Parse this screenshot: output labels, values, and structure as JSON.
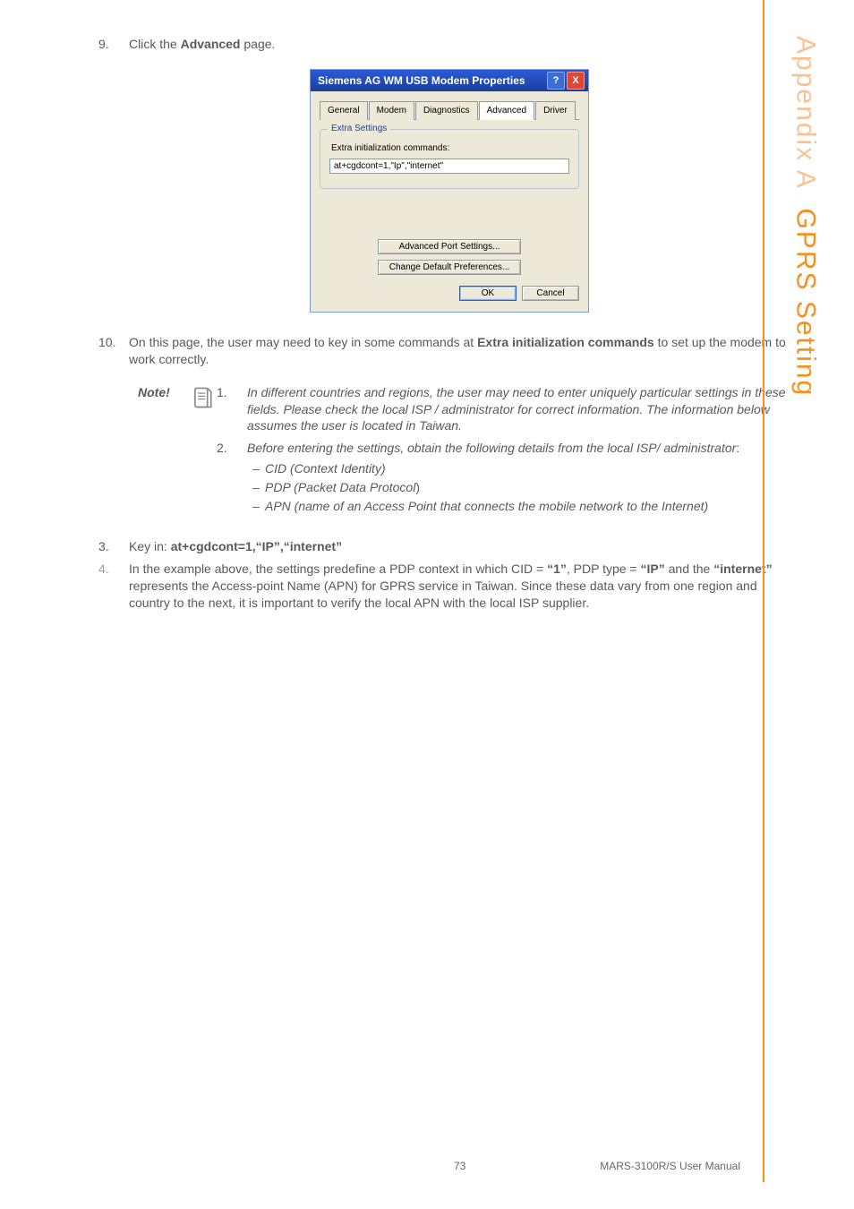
{
  "sidebar": {
    "appendix": "Appendix A",
    "section": "GPRS Setting"
  },
  "steps": {
    "s9_num": "9.",
    "s9_text_a": "Click the ",
    "s9_text_b": "Advanced",
    "s9_text_c": " page.",
    "s10_num": "10.",
    "s10_text_a": "On this page, the user may need to key in some commands at ",
    "s10_text_b": "Extra initialization commands",
    "s10_text_c": " to set up the modem to work correctly."
  },
  "dialog": {
    "title": "Siemens AG WM USB Modem Properties",
    "tabs": {
      "general": "General",
      "modem": "Modem",
      "diagnostics": "Diagnostics",
      "advanced": "Advanced",
      "driver": "Driver"
    },
    "group_legend": "Extra Settings",
    "init_label": "Extra initialization commands:",
    "init_value": "at+cgdcont=1,\"Ip\",\"internet\"",
    "btn_adv_port": "Advanced Port Settings...",
    "btn_change_pref": "Change Default Preferences...",
    "btn_ok": "OK",
    "btn_cancel": "Cancel"
  },
  "note": {
    "label": "Note!",
    "n1_num": "1.",
    "n1_text": "In different countries and regions, the user may need to enter uniquely particular settings in these fields. Please check the local ISP / administrator for correct information. The information below assumes the user is located in Taiwan.",
    "n2_num": "2.",
    "n2_text": "Before entering the settings, obtain the following details from the local ISP/ administrator",
    "n2_colon": ":",
    "b1": "CID (Context Identity)",
    "b2a": "PDP (Packet Data Protocol",
    "b2b": ")",
    "b3": "APN (name of an Access Point that connects the mobile network to the Internet)"
  },
  "post": {
    "s3_num": "3.",
    "s3_a": "Key in: ",
    "s3_b": "at+cgdcont=1,“IP”,“internet”",
    "s4_num": "4.",
    "s4_a": "In the example above, the settings predefine a PDP context in which CID = ",
    "s4_b": "“1”",
    "s4_c": ", PDP type = ",
    "s4_d": "“IP”",
    "s4_e": " and the ",
    "s4_f": "“internet”",
    "s4_g": " represents the Access-point Name (APN) for GPRS service in Taiwan.  Since these data vary from one region and country to the next, it is important to verify the local APN with the local ISP supplier."
  },
  "footer": {
    "page": "73",
    "manual": "MARS-3100R/S User Manual"
  }
}
